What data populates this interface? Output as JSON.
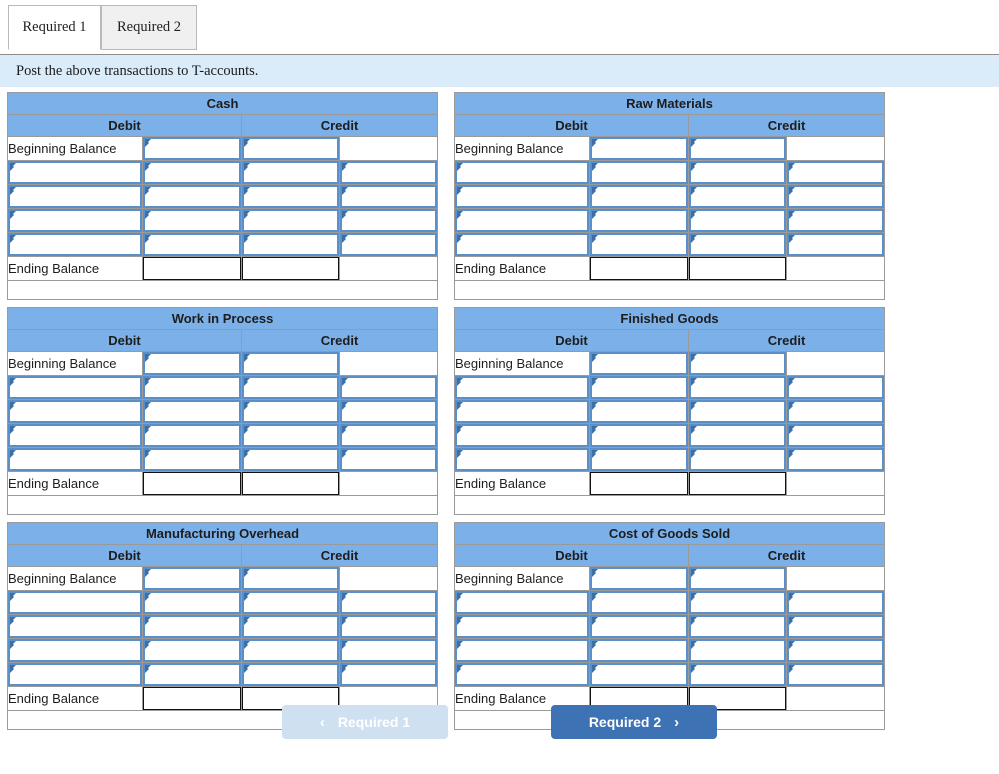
{
  "tabs": [
    {
      "label": "Required 1",
      "active": true
    },
    {
      "label": "Required 2",
      "active": false
    }
  ],
  "instruction": {
    "text": "Post the above transactions to T-accounts."
  },
  "columns": {
    "debit": "Debit",
    "credit": "Credit"
  },
  "row_labels": {
    "beginning": "Beginning Balance",
    "ending": "Ending Balance"
  },
  "accounts": [
    {
      "title": "Cash",
      "entry_rows": 4,
      "beginning_inputs": 2,
      "ending_boxes": 2
    },
    {
      "title": "Raw Materials",
      "entry_rows": 4,
      "beginning_inputs": 2,
      "ending_boxes": 2
    },
    {
      "title": "Work in Process",
      "entry_rows": 4,
      "beginning_inputs": 2,
      "ending_boxes": 2
    },
    {
      "title": "Finished Goods",
      "entry_rows": 4,
      "beginning_inputs": 2,
      "ending_boxes": 2
    },
    {
      "title": "Manufacturing Overhead",
      "entry_rows": 4,
      "beginning_inputs": 2,
      "ending_boxes": 2
    },
    {
      "title": "Cost of Goods Sold",
      "entry_rows": 4,
      "beginning_inputs": 2,
      "ending_boxes": 2
    }
  ],
  "footer": {
    "prev": {
      "label": "Required 1",
      "chevron": "chevron-left-icon",
      "glyph": "‹",
      "disabled": true
    },
    "next": {
      "label": "Required 2",
      "chevron": "chevron-right-icon",
      "glyph": "›",
      "disabled": false
    }
  },
  "colors": {
    "header_blue": "#7cb0e8",
    "banner_blue": "#daecfa",
    "input_border": "#5b8fc7",
    "input_marker": "#3b6fa8",
    "button_active": "#3d72b4",
    "button_disabled": "#cfe0f0"
  }
}
